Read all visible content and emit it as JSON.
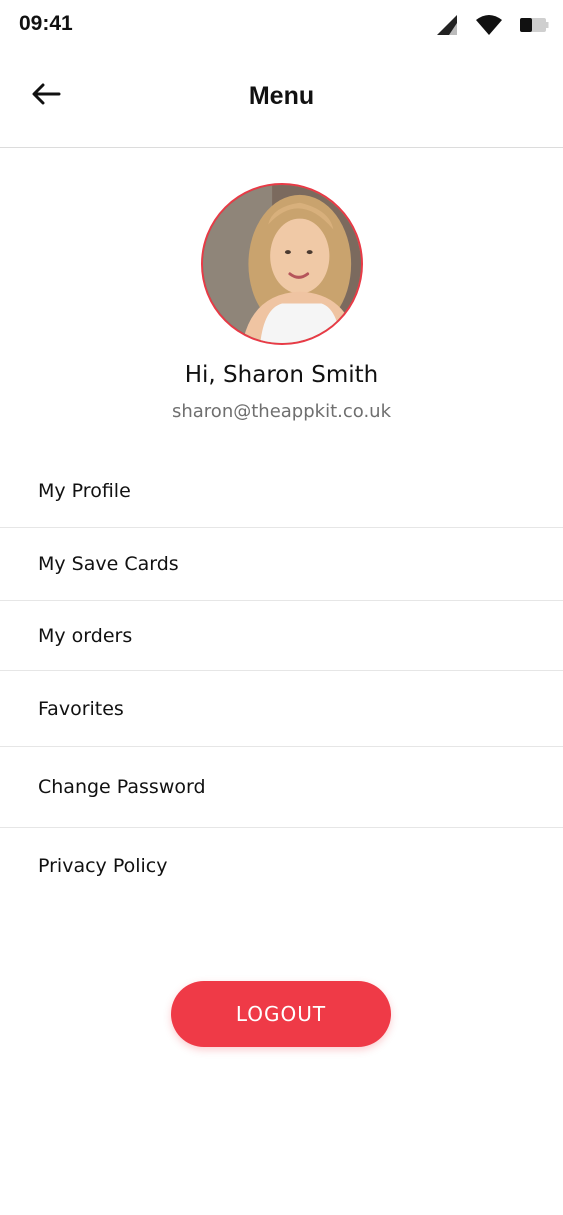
{
  "status_bar": {
    "time": "09:41",
    "icons": [
      "cellular-signal-icon",
      "wifi-icon",
      "battery-icon"
    ]
  },
  "header": {
    "title": "Menu",
    "back_icon": "arrow-left-icon"
  },
  "profile": {
    "greeting": "Hi, Sharon Smith",
    "email": "sharon@theappkit.co.uk"
  },
  "menu": {
    "items": [
      {
        "label": "My Profile"
      },
      {
        "label": "My Save Cards"
      },
      {
        "label": "My orders"
      },
      {
        "label": "Favorites"
      },
      {
        "label": "Change Password"
      },
      {
        "label": "Privacy Policy"
      }
    ]
  },
  "logout": {
    "label": "LOGOUT"
  },
  "colors": {
    "accent": "#ef3a47",
    "divider": "#e6e6e6",
    "muted_text": "#6f6f6f"
  }
}
